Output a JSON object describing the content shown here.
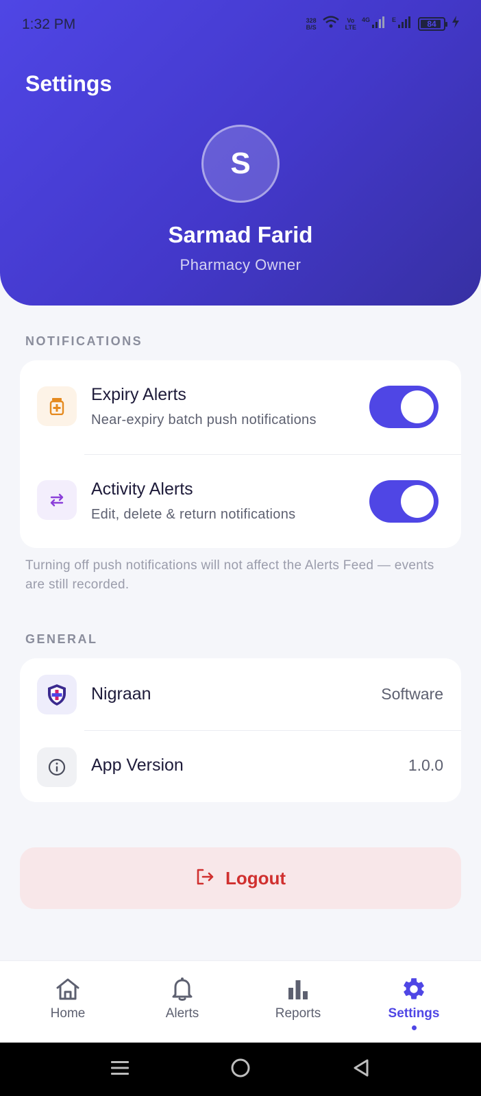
{
  "status_bar": {
    "time": "1:32 PM",
    "net_speed_value": "328",
    "net_speed_unit": "B/S",
    "volte_top": "Vo",
    "volte_bottom": "LTE",
    "signal1_label": "4G",
    "signal2_label": "E",
    "battery": "84"
  },
  "header": {
    "title": "Settings",
    "avatar_initial": "S",
    "user_name": "Sarmad Farid",
    "user_role": "Pharmacy Owner"
  },
  "notifications": {
    "section_label": "NOTIFICATIONS",
    "items": [
      {
        "title": "Expiry Alerts",
        "subtitle": "Near-expiry batch push notifications",
        "enabled": true,
        "icon": "medicine-bottle-icon"
      },
      {
        "title": "Activity Alerts",
        "subtitle": "Edit, delete & return notifications",
        "enabled": true,
        "icon": "swap-arrows-icon"
      }
    ],
    "note": "Turning off push notifications will not affect the Alerts Feed — events are still recorded."
  },
  "general": {
    "section_label": "GENERAL",
    "items": [
      {
        "title": "Nigraan",
        "value": "Software",
        "icon": "shield-logo-icon"
      },
      {
        "title": "App Version",
        "value": "1.0.0",
        "icon": "info-icon"
      }
    ]
  },
  "logout": {
    "label": "Logout",
    "icon": "logout-icon"
  },
  "bottom_nav": {
    "items": [
      {
        "label": "Home",
        "icon": "home-icon",
        "active": false
      },
      {
        "label": "Alerts",
        "icon": "bell-icon",
        "active": false
      },
      {
        "label": "Reports",
        "icon": "bar-chart-icon",
        "active": false
      },
      {
        "label": "Settings",
        "icon": "gear-icon",
        "active": true
      }
    ]
  },
  "colors": {
    "accent": "#4f46e5",
    "header_gradient_start": "#4f46e5",
    "header_gradient_end": "#3730a3",
    "danger": "#d0302f",
    "danger_bg": "#f8e7e9",
    "background": "#f5f6fa"
  }
}
